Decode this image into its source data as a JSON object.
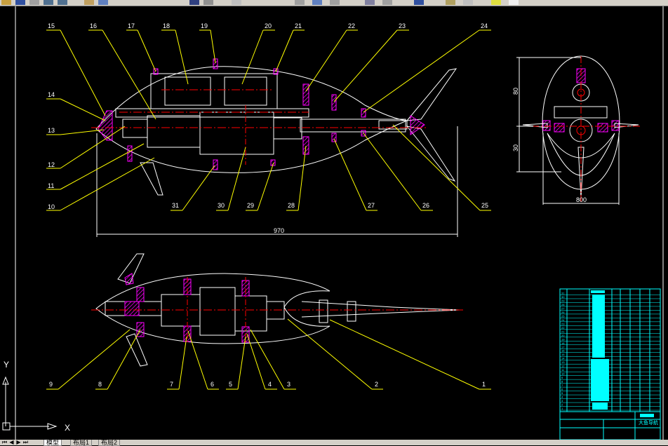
{
  "toolbar": {
    "icons": [
      "open-icon",
      "save-icon",
      "print-icon",
      "undo-icon",
      "redo-icon",
      "pan-icon",
      "zoom-icon",
      "properties-icon",
      "layer-icon",
      "match-icon"
    ]
  },
  "drawing": {
    "dimensions": {
      "overall_length": "970",
      "front_width": "800",
      "front_height_top": "80",
      "front_height_bottom": "30"
    },
    "callouts": {
      "top": [
        "15",
        "16",
        "17",
        "18",
        "19",
        "20",
        "21",
        "22",
        "23",
        "24"
      ],
      "left": [
        "14",
        "13",
        "12",
        "11",
        "10"
      ],
      "bottom": [
        "31",
        "30",
        "29",
        "28",
        "27",
        "26",
        "25"
      ],
      "lower": [
        "9",
        "8",
        "7",
        "6",
        "5",
        "4",
        "3",
        "2",
        "1"
      ]
    },
    "title_block": {
      "name": "大鱼导航",
      "rows": [
        "1",
        "2",
        "3",
        "4",
        "5",
        "6",
        "7",
        "8",
        "9",
        "10",
        "11",
        "12",
        "13",
        "14",
        "15",
        "16",
        "17",
        "18",
        "19",
        "20",
        "21",
        "22",
        "23",
        "24",
        "25",
        "26",
        "27",
        "28",
        "29",
        "30",
        "31"
      ]
    }
  },
  "ucs": {
    "y_label": "Y",
    "x_label": "X"
  },
  "tabs": {
    "model": "模型",
    "layout1": "布局1",
    "layout2": "布局2"
  },
  "colors": {
    "background": "#000000",
    "outline": "#ffffff",
    "callout": "#ffff00",
    "centerline": "#ff0000",
    "hatch": "#ff00ff",
    "title_block": "#00ffff"
  }
}
